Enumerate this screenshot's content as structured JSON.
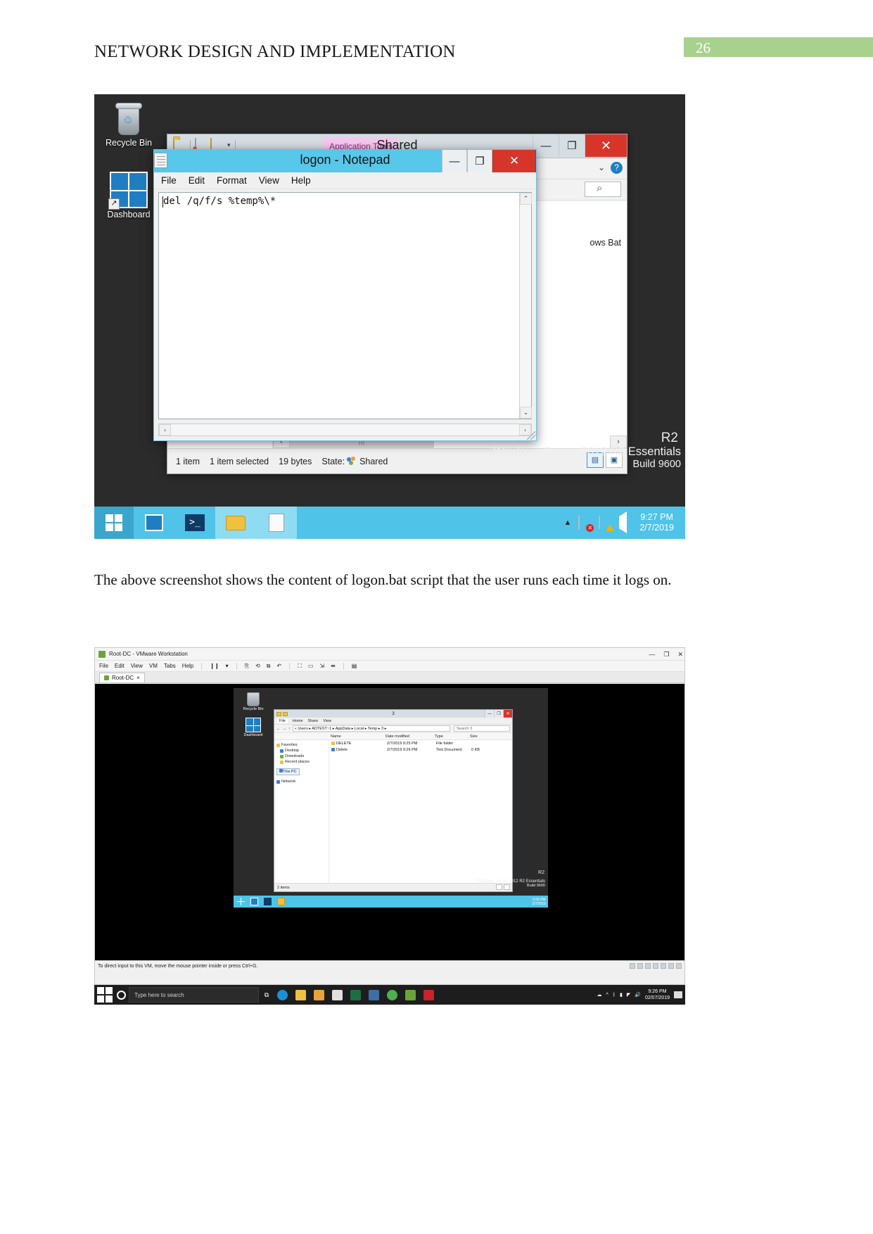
{
  "document": {
    "header_title": "NETWORK DESIGN AND IMPLEMENTATION",
    "page_number": "26",
    "badge_color": "#a9d18e",
    "paragraph": "The above screenshot shows the content of logon.bat script that the user runs each time it logs on."
  },
  "screenshot1": {
    "desktop_icons": [
      {
        "name": "Recycle Bin",
        "label": "Recycle Bin",
        "icon": "recycle-bin-icon"
      },
      {
        "name": "Dashboard",
        "label": "Dashboard",
        "icon": "dashboard-icon"
      }
    ],
    "explorer": {
      "title": "Shared",
      "contextual_tab": "Application Tools",
      "window_buttons": {
        "minimize": "—",
        "maximize": "❐",
        "close": "✕"
      },
      "help_icon": "help-icon",
      "search_icon": "search-icon",
      "files_label": "ows Bat",
      "status": {
        "item_count": "1 item",
        "selected": "1 item selected",
        "size": "19 bytes",
        "state_label": "State:",
        "state_value": "Shared"
      },
      "scroll_left": "‹",
      "scroll_right": "›",
      "thumb_grip": "|||"
    },
    "notepad": {
      "title": "logon - Notepad",
      "menu": [
        "File",
        "Edit",
        "Format",
        "View",
        "Help"
      ],
      "content": "del /q/f/s %temp%\\*",
      "window_buttons": {
        "minimize": "—",
        "maximize": "❐",
        "close": "✕"
      },
      "scroll_up": "⌃",
      "scroll_down": "⌄",
      "scroll_left": "‹",
      "scroll_right": "›"
    },
    "watermark": {
      "line0": "R2",
      "line1": "Windows Server 2012 R2 Essentials",
      "line2": "Build 9600"
    },
    "taskbar": {
      "start_icon": "windows-start-icon",
      "items": [
        "dashboard-icon",
        "powershell-icon",
        "file-explorer-icon",
        "notepad-icon"
      ],
      "tray_up_arrow": "▲",
      "tray_icons": [
        "flag-error-icon",
        "network-warning-icon",
        "volume-icon"
      ],
      "time": "9:27 PM",
      "date": "2/7/2019"
    }
  },
  "screenshot2": {
    "vmware": {
      "title": "Root-DC - VMware Workstation",
      "menu": [
        "File",
        "Edit",
        "View",
        "VM",
        "Tabs",
        "Help"
      ],
      "tab_label": "Root-DC",
      "tab_close": "×",
      "window_buttons": {
        "minimize": "—",
        "maximize": "❐",
        "close": "✕"
      },
      "hint": "To direct input to this VM, move the mouse pointer inside or press Ctrl+G."
    },
    "guest": {
      "desktop_icons": [
        {
          "label": "Recycle Bin",
          "icon": "recycle-bin-icon"
        },
        {
          "label": "Dashboard",
          "icon": "dashboard-icon"
        }
      ],
      "explorer": {
        "title": "3",
        "ribbon_tabs": [
          "File",
          "Home",
          "Share",
          "View"
        ],
        "breadcrumb": "« Users ▸ ADTEST~1 ▸ AppData ▸ Local ▸ Temp ▸ 3 ▸",
        "search_placeholder": "Search 3",
        "columns": [
          "Name",
          "Date modified",
          "Type",
          "Size"
        ],
        "nav_items": [
          "Favorites",
          "Desktop",
          "Downloads",
          "Recent places",
          "This PC",
          "Network"
        ],
        "rows": [
          {
            "name": "DELETE",
            "date": "2/7/2019 9:25 PM",
            "type": "File folder",
            "size": ""
          },
          {
            "name": "Delete",
            "date": "2/7/2019 9:26 PM",
            "type": "Text Document",
            "size": "0 KB"
          }
        ],
        "status": "2 items"
      },
      "watermark": {
        "line0": "R2",
        "line1": "Windows Server 2012 R2 Essentials",
        "line2": "Build 9600"
      },
      "taskbar": {
        "time": "9:26 PM",
        "date": "2/7/2019"
      }
    },
    "host_taskbar": {
      "search_placeholder": "Type here to search",
      "time": "9:26 PM",
      "date": "02/07/2019",
      "start_icon": "windows-start-icon",
      "cortana_icon": "cortana-icon",
      "task_view_icon": "task-view-icon"
    }
  }
}
